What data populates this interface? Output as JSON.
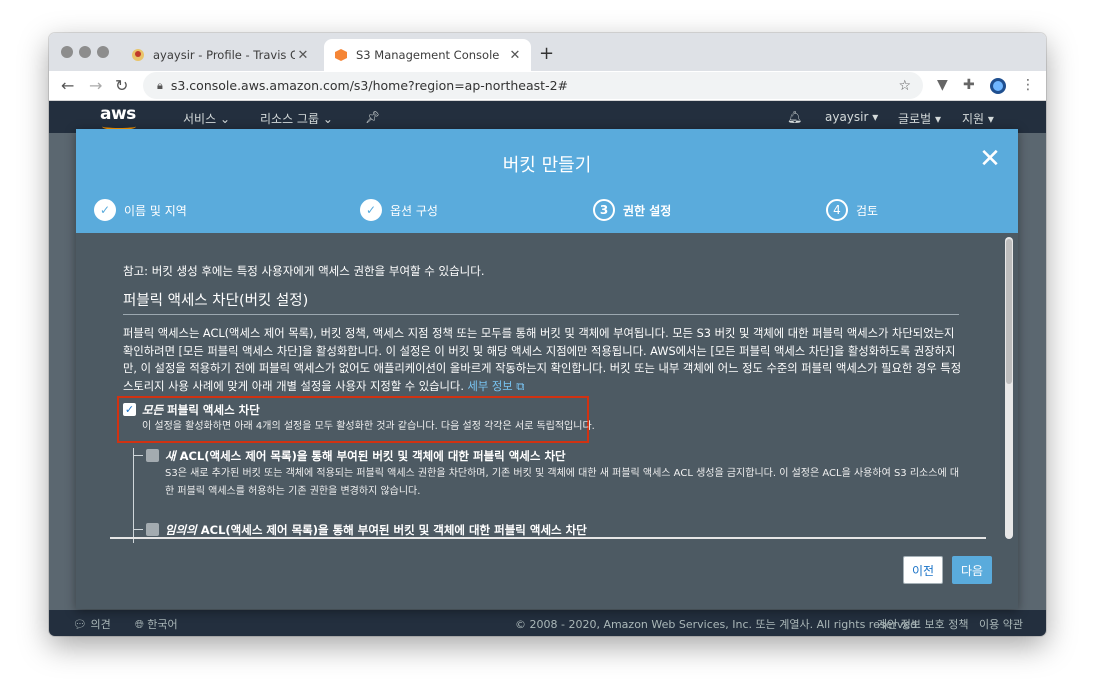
{
  "browser": {
    "tabs": [
      {
        "title": "ayaysir - Profile - Travis CI",
        "active": false
      },
      {
        "title": "S3 Management Console",
        "active": true
      }
    ],
    "url": "s3.console.aws.amazon.com/s3/home?region=ap-northeast-2#"
  },
  "aws_nav": {
    "logo": "aws",
    "services": "서비스",
    "resource_groups": "리소스 그룹",
    "user": "ayaysir",
    "global": "글로벌",
    "support": "지원"
  },
  "modal": {
    "title": "버킷 만들기",
    "steps": [
      {
        "number": "1",
        "label": "이름 및 지역",
        "state": "done"
      },
      {
        "number": "2",
        "label": "옵션 구성",
        "state": "done"
      },
      {
        "number": "3",
        "label": "권한 설정",
        "state": "current"
      },
      {
        "number": "4",
        "label": "검토",
        "state": "todo"
      }
    ],
    "note": "참고: 버킷 생성 후에는 특정 사용자에게 액세스 권한을 부여할 수 있습니다.",
    "section_title": "퍼블릭 액세스 차단(버킷 설정)",
    "description": "퍼블릭 액세스는 ACL(액세스 제어 목록), 버킷 정책, 액세스 지점 정책 또는 모두를 통해 버킷 및 객체에 부여됩니다. 모든 S3 버킷 및 객체에 대한 퍼블릭 액세스가 차단되었는지 확인하려면 [모든 퍼블릭 액세스 차단]을 활성화합니다. 이 설정은 이 버킷 및 해당 액세스 지점에만 적용됩니다. AWS에서는 [모든 퍼블릭 액세스 차단]을 활성화하도록 권장하지만, 이 설정을 적용하기 전에 퍼블릭 액세스가 없어도 애플리케이션이 올바르게 작동하는지 확인합니다. 버킷 또는 내부 객체에 어느 정도 수준의 퍼블릭 액세스가 필요한 경우 특정 스토리지 사용 사례에 맞게 아래 개별 설정을 사용자 지정할 수 있습니다.",
    "learn_more": "세부 정보",
    "block_all": {
      "label_em": "모든",
      "label_rest": " 퍼블릭 액세스 차단",
      "desc": "이 설정을 활성화하면 아래 4개의 설정을 모두 활성화한 것과 같습니다. 다음 설정 각각은 서로 독립적입니다.",
      "checked": true
    },
    "option1": {
      "label_em": "새",
      "label_rest": " ACL(액세스 제어 목록)을 통해 부여된 버킷 및 객체에 대한 퍼블릭 액세스 차단",
      "desc": "S3은 새로 추가된 버킷 또는 객체에 적용되는 퍼블릭 액세스 권한을 차단하며, 기존 버킷 및 객체에 대한 새 퍼블릭 액세스 ACL 생성을 금지합니다. 이 설정은 ACL을 사용하여 S3 리소스에 대한 퍼블릭 액세스를 허용하는 기존 권한을 변경하지 않습니다.",
      "checked": false
    },
    "option2": {
      "label_em": "임의의",
      "label_rest": " ACL(액세스 제어 목록)을 통해 부여된 버킷 및 객체에 대한 퍼블릭 액세스 차단",
      "checked": false
    },
    "prev": "이전",
    "next": "다음"
  },
  "footer": {
    "feedback": "의견",
    "language": "한국어",
    "copyright": "© 2008 - 2020, Amazon Web Services, Inc. 또는 계열사. All rights reserved.",
    "privacy": "개인 정보 보호 정책",
    "terms": "이용 약관"
  },
  "colors": {
    "header_blue": "#5aabdc",
    "modal_bg": "#4d5a63",
    "aws_nav": "#232f3e",
    "highlight_red": "#d13212"
  }
}
